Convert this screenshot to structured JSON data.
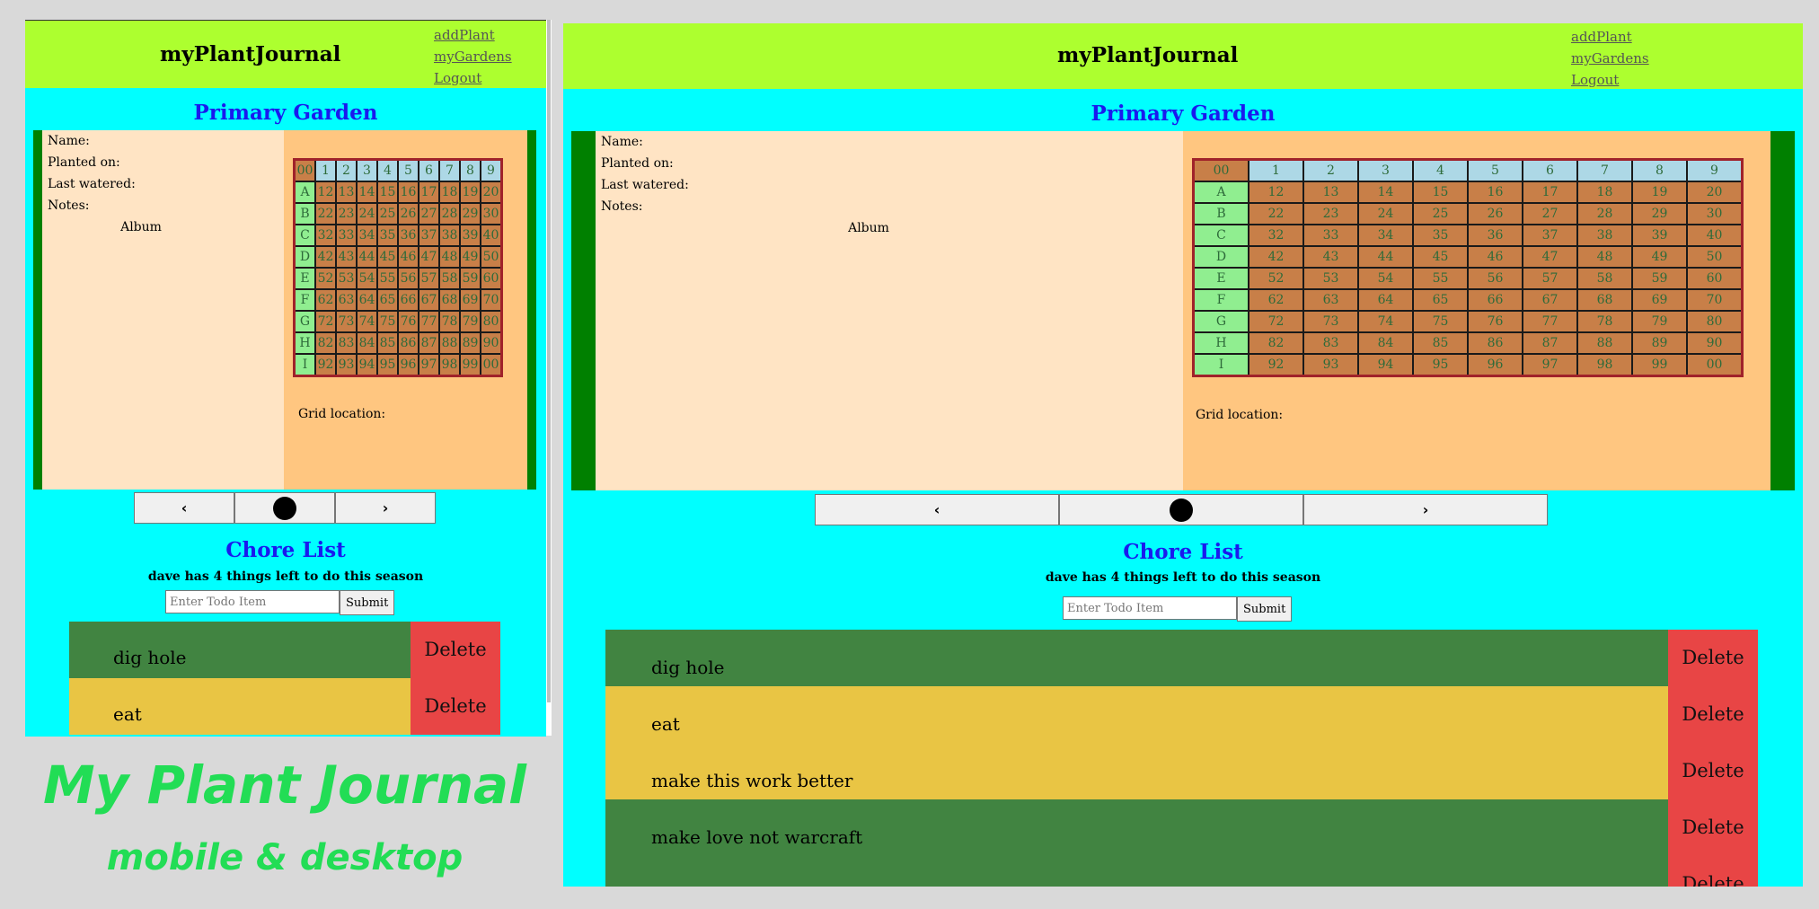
{
  "app_title": "myPlantJournal",
  "nav": [
    "addPlant",
    "myGardens",
    "Logout"
  ],
  "garden": {
    "title": "Primary Garden",
    "info_labels": [
      "Name:",
      "Planted on:",
      "Last watered:",
      "Notes:"
    ],
    "album_label": "Album",
    "grid_location_label": "Grid location:",
    "grid": {
      "corner": "00",
      "columns": [
        "1",
        "2",
        "3",
        "4",
        "5",
        "6",
        "7",
        "8",
        "9"
      ],
      "rows": [
        {
          "label": "A",
          "cells": [
            "12",
            "13",
            "14",
            "15",
            "16",
            "17",
            "18",
            "19",
            "20"
          ]
        },
        {
          "label": "B",
          "cells": [
            "22",
            "23",
            "24",
            "25",
            "26",
            "27",
            "28",
            "29",
            "30"
          ]
        },
        {
          "label": "C",
          "cells": [
            "32",
            "33",
            "34",
            "35",
            "36",
            "37",
            "38",
            "39",
            "40"
          ]
        },
        {
          "label": "D",
          "cells": [
            "42",
            "43",
            "44",
            "45",
            "46",
            "47",
            "48",
            "49",
            "50"
          ]
        },
        {
          "label": "E",
          "cells": [
            "52",
            "53",
            "54",
            "55",
            "56",
            "57",
            "58",
            "59",
            "60"
          ]
        },
        {
          "label": "F",
          "cells": [
            "62",
            "63",
            "64",
            "65",
            "66",
            "67",
            "68",
            "69",
            "70"
          ]
        },
        {
          "label": "G",
          "cells": [
            "72",
            "73",
            "74",
            "75",
            "76",
            "77",
            "78",
            "79",
            "80"
          ]
        },
        {
          "label": "H",
          "cells": [
            "82",
            "83",
            "84",
            "85",
            "86",
            "87",
            "88",
            "89",
            "90"
          ]
        },
        {
          "label": "I",
          "cells": [
            "92",
            "93",
            "94",
            "95",
            "96",
            "97",
            "98",
            "99",
            "00"
          ]
        }
      ]
    }
  },
  "carousel": {
    "prev_icon": "chevron-left-icon",
    "next_icon": "chevron-right-icon",
    "prev_glyph": "‹",
    "next_glyph": "›"
  },
  "chores": {
    "title": "Chore List",
    "subtitle": "dave has 4 things left to do this season",
    "input_placeholder": "Enter Todo Item",
    "submit_label": "Submit",
    "delete_label": "Delete",
    "items": [
      {
        "text": "dig hole",
        "color": "green"
      },
      {
        "text": "eat",
        "color": "yellow"
      },
      {
        "text": "make this work better",
        "color": "yellow"
      },
      {
        "text": "make love not warcraft",
        "color": "green"
      },
      {
        "text": "",
        "color": "green"
      }
    ]
  },
  "colors": {
    "header": "#adff2f",
    "background": "#00ffff",
    "heading": "#1a1aee",
    "chore_green": "#418441",
    "chore_yellow": "#e9c544",
    "delete": "#e84545"
  },
  "promo": {
    "line1": "My Plant Journal",
    "line2": "mobile & desktop"
  }
}
